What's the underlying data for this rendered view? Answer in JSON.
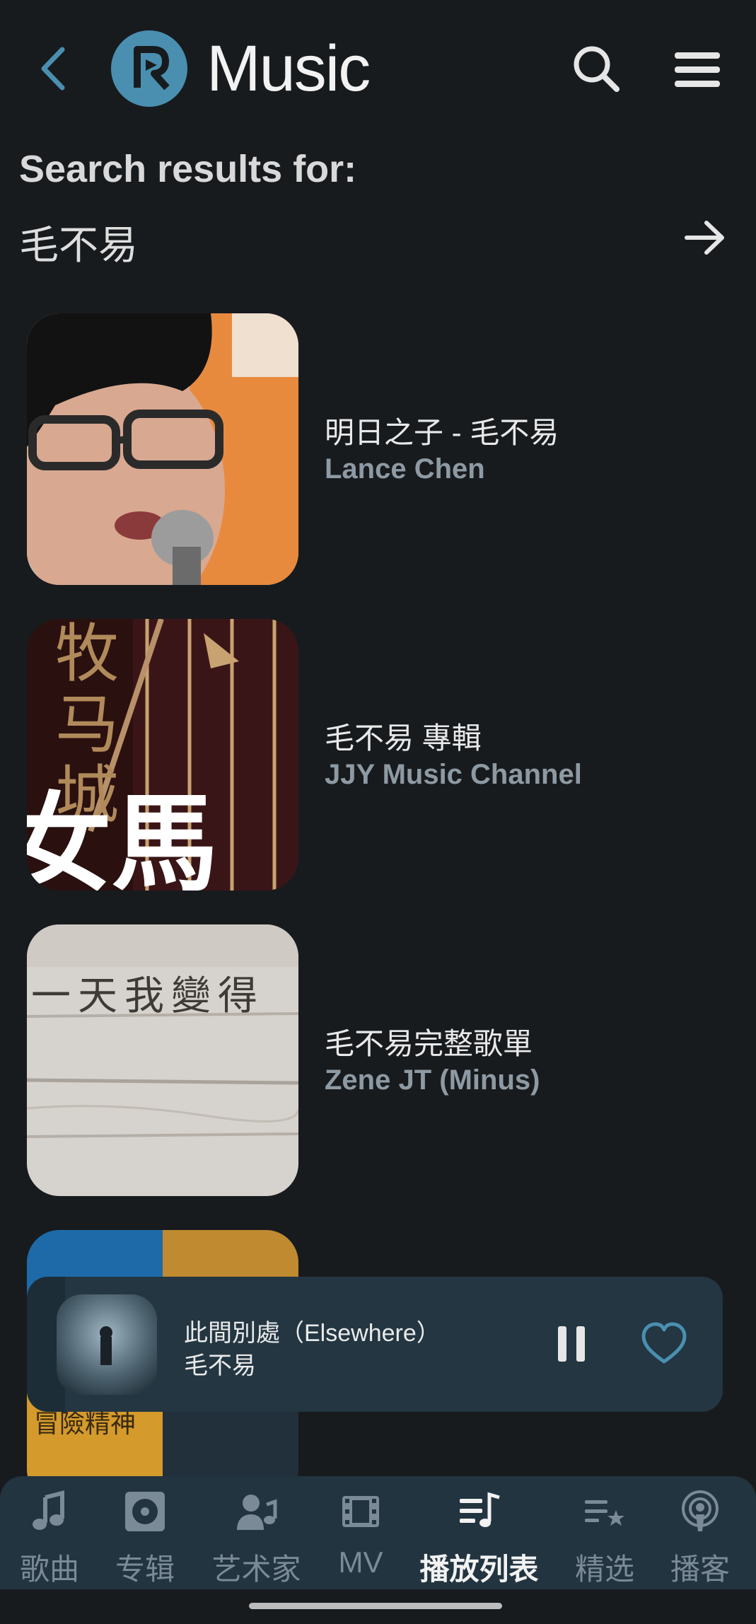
{
  "header": {
    "app_name": "Music"
  },
  "search": {
    "label": "Search results for:",
    "query": "毛不易"
  },
  "results": [
    {
      "title": "明日之子 - 毛不易",
      "subtitle": "Lance Chen"
    },
    {
      "title": "毛不易 專輯",
      "subtitle": "JJY Music Channel"
    },
    {
      "title": "毛不易完整歌單",
      "subtitle": "Zene JT (Minus)"
    }
  ],
  "thumb_text": {
    "r3": "一天我變得",
    "r4": "冒險精神"
  },
  "player": {
    "title": "此間別處（Elsewhere）",
    "artist": "毛不易"
  },
  "tabs": [
    {
      "label": "歌曲",
      "icon": "music-note-icon"
    },
    {
      "label": "专辑",
      "icon": "album-icon"
    },
    {
      "label": "艺术家",
      "icon": "artist-icon"
    },
    {
      "label": "MV",
      "icon": "film-icon"
    },
    {
      "label": "播放列表",
      "icon": "playlist-icon"
    },
    {
      "label": "精选",
      "icon": "featured-list-icon"
    },
    {
      "label": "播客",
      "icon": "podcast-icon"
    }
  ],
  "active_tab": "播放列表",
  "colors": {
    "background": "#181b1e",
    "accent": "#4a8fb0",
    "player_bg": "#233642",
    "tabbar_bg": "#223440"
  }
}
